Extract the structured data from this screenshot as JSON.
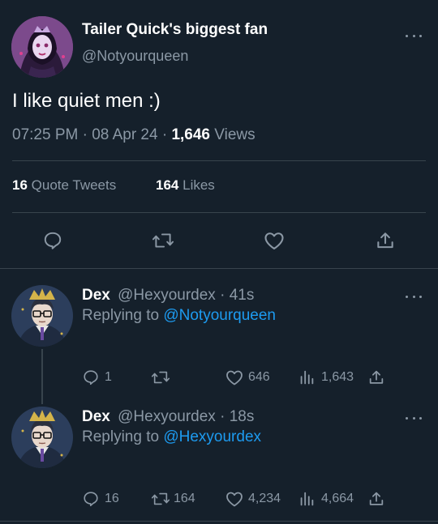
{
  "main_tweet": {
    "author_name": "Tailer Quick's biggest fan",
    "author_handle": "@Notyourqueen",
    "text": "I like quiet men :)",
    "time": "07:25 PM",
    "sep1": "·",
    "date": "08 Apr 24",
    "sep2": "·",
    "views_count": "1,646",
    "views_label": "Views",
    "quote_count": "16",
    "quote_label": "Quote Tweets",
    "likes_count": "164",
    "likes_label": "Likes"
  },
  "reply1": {
    "author_name": "Dex",
    "author_handle": "@Hexyourdex",
    "time_sep": "·",
    "time": "41s",
    "replying_prefix": "Replying to",
    "replying_to": "@Notyourqueen",
    "reply_count": "1",
    "retweet_count": "",
    "like_count": "646",
    "views_count": "1,643"
  },
  "reply2": {
    "author_name": "Dex",
    "author_handle": "@Hexyourdex",
    "time_sep": "·",
    "time": "18s",
    "replying_prefix": "Replying to",
    "replying_to": "@Hexyourdex",
    "reply_count": "16",
    "retweet_count": "164",
    "like_count": "4,234",
    "views_count": "4,664"
  },
  "colors": {
    "background": "#15202b",
    "muted": "#8b98a5",
    "accent": "#1d9bf0",
    "divider": "#38444d"
  },
  "icons": [
    "more-icon",
    "reply-icon",
    "retweet-icon",
    "like-icon",
    "share-icon",
    "views-icon"
  ]
}
